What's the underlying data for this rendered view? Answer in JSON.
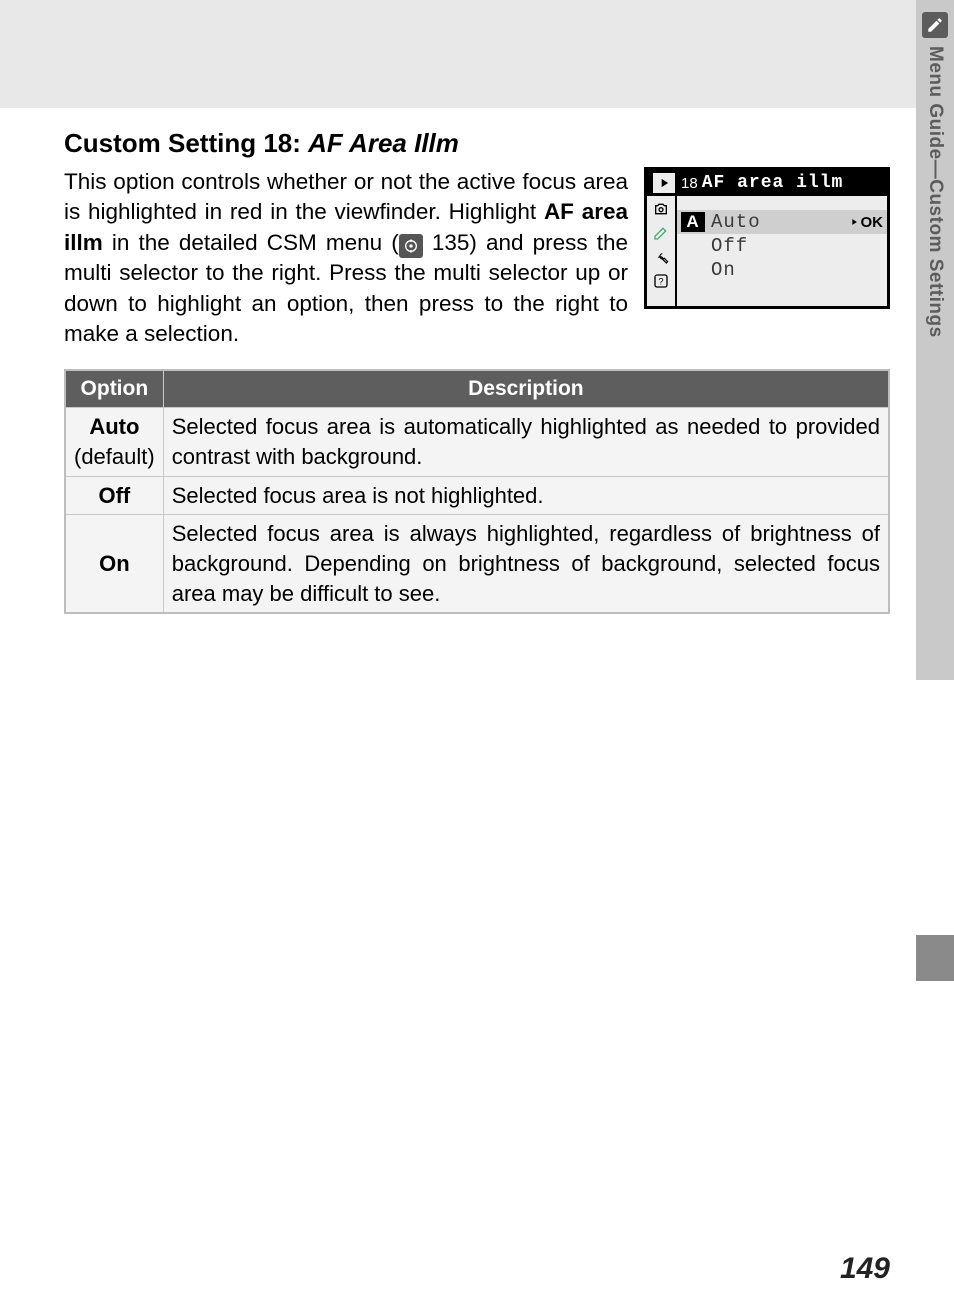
{
  "heading": {
    "prefix": "Custom Setting 18: ",
    "title_italic": "AF Area Illm"
  },
  "body": {
    "p1a": "This option controls whether or not the active focus area is highlighted in red in the viewfinder. Highlight ",
    "p1_bold": "AF area illm",
    "p1b": " in the detailed CSM menu (",
    "p1_ref": " 135) and press the multi selector to the right. Press the multi selector up or down to highlight an option, then press to the right to make a selection."
  },
  "lcd": {
    "menu_number": "18",
    "menu_title": "AF area illm",
    "items": [
      {
        "badge": "A",
        "label": "Auto",
        "selected": true,
        "ok": "OK"
      },
      {
        "label": "Off"
      },
      {
        "label": "On"
      }
    ]
  },
  "table": {
    "headers": {
      "option": "Option",
      "description": "Description"
    },
    "rows": [
      {
        "option": "Auto",
        "option_sub": "(default)",
        "description": "Selected focus area is automatically highlighted as needed to provided contrast with background.",
        "justify": true
      },
      {
        "option": "Off",
        "description": "Selected focus area is not highlighted."
      },
      {
        "option": "On",
        "description": "Selected focus area is always highlighted, regardless of brightness of background.  Depending on brightness of background, selected focus area may be difficult to see.",
        "justify": true
      }
    ]
  },
  "side": {
    "label": "Menu Guide—Custom Settings"
  },
  "page_number": "149"
}
